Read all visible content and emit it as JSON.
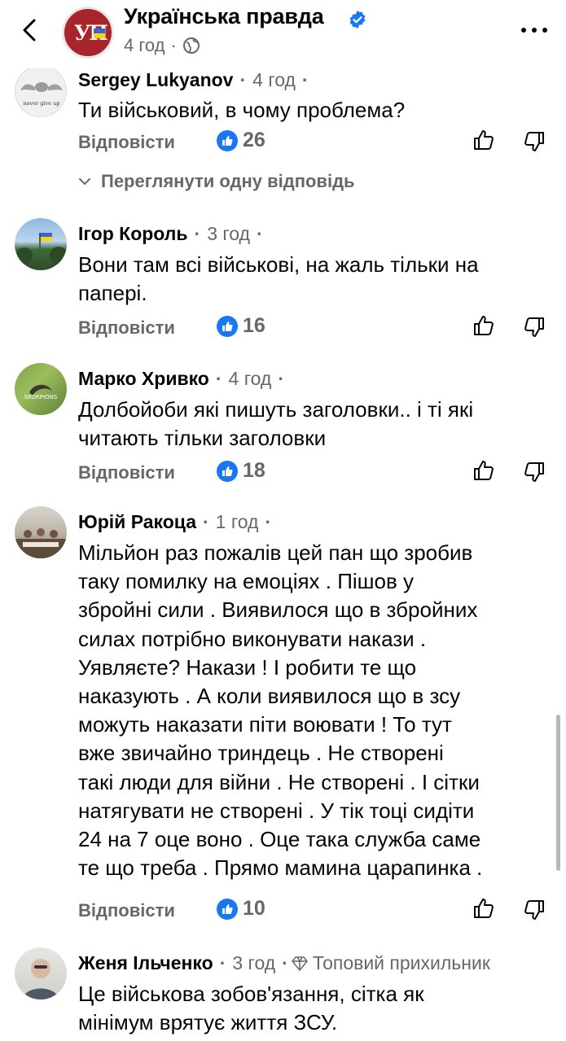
{
  "header": {
    "page_name": "Українська правда",
    "logo_text": "УП",
    "post_time": "4 год",
    "separator": "·",
    "more_label": "..."
  },
  "comments": [
    {
      "author": "Sergey  Lukyanov",
      "time": "4 год",
      "dots": "·",
      "text": "Ти військовий, в чому проблема?",
      "reply": "Відповісти",
      "likes": "26",
      "avatar_caption": "never give up",
      "view_replies": "Переглянути одну відповідь"
    },
    {
      "author": "Ігор Король",
      "time": "3 год",
      "dots": "·",
      "text": "Вони там всі військові, на жаль тільки на\nпапері.",
      "reply": "Відповісти",
      "likes": "16"
    },
    {
      "author": "Марко Хривко",
      "time": "4 год",
      "dots": "·",
      "text": "Долбойоби які пишуть заголовки.. і ті які\nчитають тільки заголовки",
      "reply": "Відповісти",
      "likes": "18",
      "avatar_caption": "SKORPIONS"
    },
    {
      "author": "Юрій Ракоца",
      "time": "1 год",
      "dots": "·",
      "text": "Мільйон раз пожалів цей пан що зробив\nтаку помилку на  емоціях . Пішов у\nзбройні сили . Виявилося що в збройних\nсилах потрібно виконувати накази .\nУявляєте? Накази ! І робити те що\nнаказують . А коли виявилося що в зсу\nможуть наказати піти воювати ! То тут\nвже звичайно триндець . Не створені\nтакі люди для війни . Не створені . І сітки\nнатягувати не створені . У тік тоці сидіти\n24 на 7 оце воно . Оце така служба саме\nте що треба . Прямо мамина царапинка .",
      "reply": "Відповісти",
      "likes": "10"
    },
    {
      "author": "Женя Ільченко",
      "time": "3 год",
      "dots": "·",
      "badge": "Топовий прихильник",
      "text": "Це військова зобов'язання, сітка як\nмінімум врятує життя ЗСУ."
    }
  ],
  "colors": {
    "text": "#050505",
    "secondary": "#65676b",
    "like_blue": "#1877f2",
    "logo_red": "#a8262b"
  },
  "icons": [
    "back-arrow-icon",
    "verified-icon",
    "globe-icon",
    "more-icon",
    "like-icon",
    "thumbs-up-icon",
    "thumbs-down-icon",
    "chevron-down-icon",
    "diamond-icon"
  ]
}
